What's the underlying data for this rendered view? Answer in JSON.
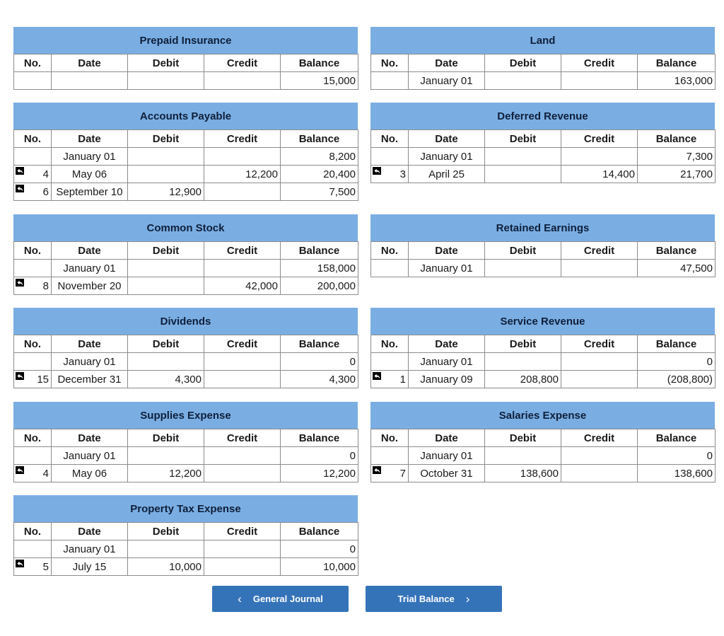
{
  "columns": [
    "No.",
    "Date",
    "Debit",
    "Credit",
    "Balance"
  ],
  "ledgers": [
    {
      "title": "Prepaid Insurance",
      "rows": [
        {
          "no": "",
          "date": "",
          "debit": "",
          "credit": "",
          "balance": "15,000",
          "link": false
        }
      ]
    },
    {
      "title": "Land",
      "rows": [
        {
          "no": "",
          "date": "January 01",
          "debit": "",
          "credit": "",
          "balance": "163,000",
          "link": false
        }
      ]
    },
    {
      "title": "Accounts Payable",
      "rows": [
        {
          "no": "",
          "date": "January 01",
          "debit": "",
          "credit": "",
          "balance": "8,200",
          "link": false
        },
        {
          "no": "4",
          "date": "May 06",
          "debit": "",
          "credit": "12,200",
          "balance": "20,400",
          "link": true
        },
        {
          "no": "6",
          "date": "September 10",
          "debit": "12,900",
          "credit": "",
          "balance": "7,500",
          "link": true
        }
      ]
    },
    {
      "title": "Deferred Revenue",
      "rows": [
        {
          "no": "",
          "date": "January 01",
          "debit": "",
          "credit": "",
          "balance": "7,300",
          "link": false
        },
        {
          "no": "3",
          "date": "April 25",
          "debit": "",
          "credit": "14,400",
          "balance": "21,700",
          "link": true
        }
      ]
    },
    {
      "title": "Common Stock",
      "rows": [
        {
          "no": "",
          "date": "January 01",
          "debit": "",
          "credit": "",
          "balance": "158,000",
          "link": false
        },
        {
          "no": "8",
          "date": "November 20",
          "debit": "",
          "credit": "42,000",
          "balance": "200,000",
          "link": true
        }
      ]
    },
    {
      "title": "Retained Earnings",
      "rows": [
        {
          "no": "",
          "date": "January 01",
          "debit": "",
          "credit": "",
          "balance": "47,500",
          "link": false
        }
      ]
    },
    {
      "title": "Dividends",
      "rows": [
        {
          "no": "",
          "date": "January 01",
          "debit": "",
          "credit": "",
          "balance": "0",
          "link": false
        },
        {
          "no": "15",
          "date": "December 31",
          "debit": "4,300",
          "credit": "",
          "balance": "4,300",
          "link": true
        }
      ]
    },
    {
      "title": "Service Revenue",
      "rows": [
        {
          "no": "",
          "date": "January 01",
          "debit": "",
          "credit": "",
          "balance": "0",
          "link": false
        },
        {
          "no": "1",
          "date": "January 09",
          "debit": "208,800",
          "credit": "",
          "balance": "(208,800)",
          "link": true
        }
      ]
    },
    {
      "title": "Supplies Expense",
      "rows": [
        {
          "no": "",
          "date": "January 01",
          "debit": "",
          "credit": "",
          "balance": "0",
          "link": false
        },
        {
          "no": "4",
          "date": "May 06",
          "debit": "12,200",
          "credit": "",
          "balance": "12,200",
          "link": true
        }
      ]
    },
    {
      "title": "Salaries Expense",
      "rows": [
        {
          "no": "",
          "date": "January 01",
          "debit": "",
          "credit": "",
          "balance": "0",
          "link": false
        },
        {
          "no": "7",
          "date": "October 31",
          "debit": "138,600",
          "credit": "",
          "balance": "138,600",
          "link": true
        }
      ]
    },
    {
      "title": "Property Tax Expense",
      "rows": [
        {
          "no": "",
          "date": "January 01",
          "debit": "",
          "credit": "",
          "balance": "0",
          "link": false
        },
        {
          "no": "5",
          "date": "July 15",
          "debit": "10,000",
          "credit": "",
          "balance": "10,000",
          "link": true
        }
      ]
    }
  ],
  "nav": {
    "prev_label": "General Journal",
    "next_label": "Trial Balance",
    "prev_icon": "chevron-left-icon",
    "next_icon": "chevron-right-icon",
    "button_color": "#3573b9"
  },
  "colors": {
    "header_bg": "#7aaee3",
    "header_text": "#0f1f3a",
    "border": "#8c8c8c"
  }
}
